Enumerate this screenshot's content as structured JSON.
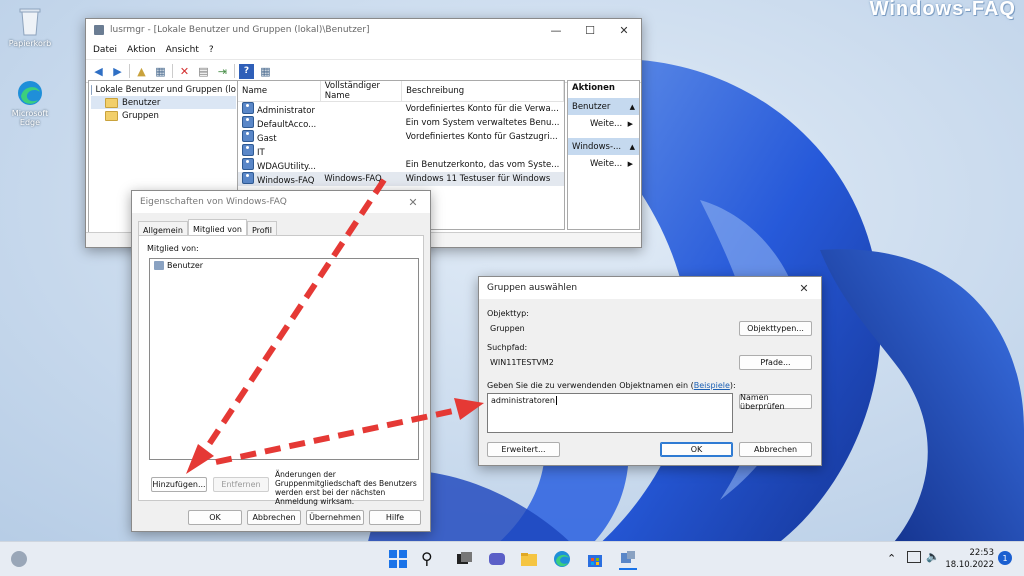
{
  "watermark": "Windows-FAQ",
  "desktop": {
    "icons": [
      {
        "label": "Papierkorb"
      },
      {
        "label": "Microsoft Edge"
      }
    ]
  },
  "mmc": {
    "title": "lusrmgr - [Lokale Benutzer und Gruppen (lokal)\\Benutzer]",
    "menu": [
      "Datei",
      "Aktion",
      "Ansicht",
      "?"
    ],
    "tree": {
      "root": "Lokale Benutzer und Gruppen (lo",
      "children": [
        "Benutzer",
        "Gruppen"
      ]
    },
    "columns": [
      "Name",
      "Vollständiger Name",
      "Beschreibung"
    ],
    "rows": [
      {
        "name": "Administrator",
        "full": "",
        "desc": "Vordefiniertes Konto für die Verwa..."
      },
      {
        "name": "DefaultAcco...",
        "full": "",
        "desc": "Ein vom System verwaltetes Benu..."
      },
      {
        "name": "Gast",
        "full": "",
        "desc": "Vordefiniertes Konto für Gastzugri..."
      },
      {
        "name": "IT",
        "full": "",
        "desc": ""
      },
      {
        "name": "WDAGUtility...",
        "full": "",
        "desc": "Ein Benutzerkonto, das vom Syste..."
      },
      {
        "name": "Windows-FAQ",
        "full": "Windows-FAQ",
        "desc": "Windows 11 Testuser für Windows"
      }
    ],
    "actions": {
      "header": "Aktionen",
      "group1": "Benutzer",
      "item1": "Weite...",
      "group2": "Windows-...",
      "item2": "Weite..."
    }
  },
  "props": {
    "title": "Eigenschaften von Windows-FAQ",
    "tabs": [
      "Allgemein",
      "Mitglied von",
      "Profil"
    ],
    "member_label": "Mitglied von:",
    "members": [
      "Benutzer"
    ],
    "add_button": "Hinzufügen...",
    "remove_button": "Entfernen",
    "note": "Änderungen der Gruppenmitgliedschaft des Benutzers werden erst bei der nächsten Anmeldung wirksam.",
    "ok": "OK",
    "cancel": "Abbrechen",
    "apply": "Übernehmen",
    "help": "Hilfe"
  },
  "select": {
    "title": "Gruppen auswählen",
    "objtype_label": "Objekttyp:",
    "objtype_value": "Gruppen",
    "objtype_button": "Objekttypen...",
    "path_label": "Suchpfad:",
    "path_value": "WIN11TESTVM2",
    "path_button": "Pfade...",
    "names_label_pre": "Geben Sie die zu verwendenden Objektnamen ein (",
    "names_link": "Beispiele",
    "names_label_post": "):",
    "names_value": "administratoren",
    "check_button": "Namen überprüfen",
    "advanced_button": "Erweitert...",
    "ok": "OK",
    "cancel": "Abbrechen"
  },
  "taskbar": {
    "time": "22:53",
    "date": "18.10.2022",
    "notifications": "1"
  },
  "colors": {
    "accent": "#2f7bd3",
    "arrow": "#e53935"
  }
}
